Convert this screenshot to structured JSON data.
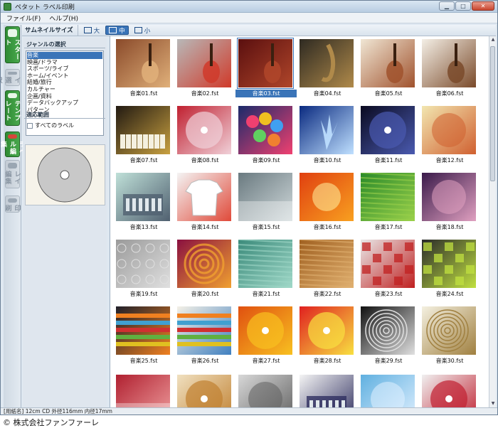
{
  "window": {
    "title": "ペタット ラベル印刷"
  },
  "menu": [
    {
      "label": "ファイル(F)"
    },
    {
      "label": "ヘルプ(H)"
    }
  ],
  "nav_tabs": [
    {
      "label": "スタート",
      "state": "active",
      "icon": "start-icon"
    },
    {
      "label": "レイ選択",
      "state": "disabled",
      "icon": "layout-icon"
    },
    {
      "label": "テンプレート",
      "state": "active",
      "icon": "template-icon"
    },
    {
      "label": "ラベル編集",
      "state": "active",
      "icon": "label-edit-icon"
    },
    {
      "label": "レイ編集",
      "state": "disabled",
      "icon": "layout-edit-icon"
    },
    {
      "label": "印刷",
      "state": "disabled",
      "icon": "print-icon"
    }
  ],
  "toolbar": {
    "label": "サムネイルサイズ",
    "sizes": [
      {
        "label": "大",
        "active": false
      },
      {
        "label": "中",
        "active": true
      },
      {
        "label": "小",
        "active": false
      }
    ]
  },
  "genre": {
    "heading": "ジャンルの選択",
    "items": [
      "音楽",
      "映画/ドラマ",
      "スポーツ/ライブ",
      "ホーム/イベント",
      "結婚/旅行",
      "カルチャー",
      "企画/資料",
      "データバックアップ",
      "パターン"
    ],
    "selected_index": 0
  },
  "scope": {
    "heading": "適応範囲",
    "checkbox_label": "すべてのラベル",
    "checked": false
  },
  "thumbnails": [
    {
      "caption": "音楽01.fst",
      "c1": "#8a4a2a",
      "c2": "#e0b07a",
      "style": "guitar"
    },
    {
      "caption": "音楽02.fst",
      "c1": "#b8b8b8",
      "c2": "#d03a2a",
      "style": "guitar"
    },
    {
      "caption": "音楽03.fst",
      "c1": "#5a0f0f",
      "c2": "#b0462a",
      "style": "guitar"
    },
    {
      "caption": "音楽04.fst",
      "c1": "#2e2a22",
      "c2": "#b08a4a",
      "style": "sax"
    },
    {
      "caption": "音楽05.fst",
      "c1": "#f0e6d4",
      "c2": "#a0522d",
      "style": "violin"
    },
    {
      "caption": "音楽06.fst",
      "c1": "#f4efe6",
      "c2": "#7a4a2a",
      "style": "cello"
    },
    {
      "caption": "音楽07.fst",
      "c1": "#221a12",
      "c2": "#c8a040",
      "style": "piano"
    },
    {
      "caption": "音楽08.fst",
      "c1": "#c02030",
      "c2": "#f0d0d8",
      "style": "disc"
    },
    {
      "caption": "音楽09.fst",
      "c1": "#1a2a6a",
      "c2": "#f04070",
      "style": "balloons"
    },
    {
      "caption": "音楽10.fst",
      "c1": "#0a2a80",
      "c2": "#bfe0ff",
      "style": "splash"
    },
    {
      "caption": "音楽11.fst",
      "c1": "#0a0a20",
      "c2": "#4a5ab0",
      "style": "disc"
    },
    {
      "caption": "音楽12.fst",
      "c1": "#f2e6b0",
      "c2": "#d06030",
      "style": "circle"
    },
    {
      "caption": "音楽13.fst",
      "c1": "#bfe0d8",
      "c2": "#506070",
      "style": "building"
    },
    {
      "caption": "音楽14.fst",
      "c1": "#f4f4f4",
      "c2": "#e04a3a",
      "style": "shirt"
    },
    {
      "caption": "音楽15.fst",
      "c1": "#6a7a80",
      "c2": "#cfd8da",
      "style": "fog"
    },
    {
      "caption": "音楽16.fst",
      "c1": "#e04010",
      "c2": "#f8a020",
      "style": "sun"
    },
    {
      "caption": "音楽17.fst",
      "c1": "#2a8a2a",
      "c2": "#9ad04a",
      "style": "lines"
    },
    {
      "caption": "音楽18.fst",
      "c1": "#3a1a4a",
      "c2": "#e0a0c0",
      "style": "circle"
    },
    {
      "caption": "音楽19.fst",
      "c1": "#9a9a9a",
      "c2": "#e0e0e0",
      "style": "pattern"
    },
    {
      "caption": "音楽20.fst",
      "c1": "#8a1040",
      "c2": "#f0a030",
      "style": "spiral"
    },
    {
      "caption": "音楽21.fst",
      "c1": "#3a8a7a",
      "c2": "#a0d8c8",
      "style": "lines"
    },
    {
      "caption": "音楽22.fst",
      "c1": "#a06020",
      "c2": "#e0b070",
      "style": "lines"
    },
    {
      "caption": "音楽23.fst",
      "c1": "#e8e8e8",
      "c2": "#c02020",
      "style": "squares"
    },
    {
      "caption": "音楽24.fst",
      "c1": "#2a2a2a",
      "c2": "#c0e040",
      "style": "squares"
    },
    {
      "caption": "音楽25.fst",
      "c1": "#20202a",
      "c2": "#f08020",
      "style": "bars"
    },
    {
      "caption": "音楽26.fst",
      "c1": "#f4f0e6",
      "c2": "#4080c0",
      "style": "bars"
    },
    {
      "caption": "音楽27.fst",
      "c1": "#e05010",
      "c2": "#f8c020",
      "style": "disc"
    },
    {
      "caption": "音楽28.fst",
      "c1": "#e02020",
      "c2": "#f8e040",
      "style": "disc"
    },
    {
      "caption": "音楽29.fst",
      "c1": "#101010",
      "c2": "#e0e0e0",
      "style": "rings"
    },
    {
      "caption": "音楽30.fst",
      "c1": "#f4f0e0",
      "c2": "#a08040",
      "style": "rings"
    },
    {
      "caption": "",
      "c1": "#b02030",
      "c2": "#f0a0a0",
      "style": "fog"
    },
    {
      "caption": "",
      "c1": "#f0e0c0",
      "c2": "#c08030",
      "style": "disc"
    },
    {
      "caption": "",
      "c1": "#d8d8d8",
      "c2": "#606060",
      "style": "circle"
    },
    {
      "caption": "",
      "c1": "#f4f4f4",
      "c2": "#303060",
      "style": "building"
    },
    {
      "caption": "",
      "c1": "#60b0e0",
      "c2": "#e0f0ff",
      "style": "circle"
    },
    {
      "caption": "",
      "c1": "#f0f0f0",
      "c2": "#c02030",
      "style": "disc"
    }
  ],
  "selected_thumbnail": 2,
  "status": {
    "text": "[用紙名] 12cm CD 外径116mm 内径17mm"
  },
  "copyright": "© 株式会社ファンファーレ"
}
